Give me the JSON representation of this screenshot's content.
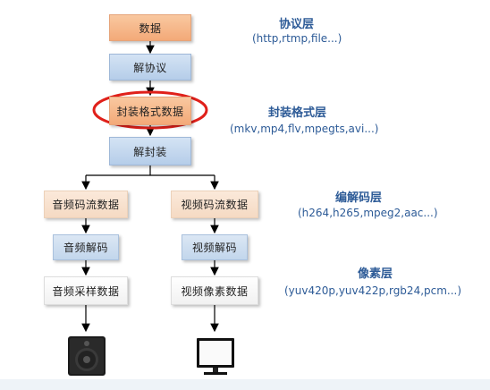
{
  "nodes": {
    "data": "数据",
    "deprotocol": "解协议",
    "container_data": "封装格式数据",
    "demux": "解封装",
    "audio_stream": "音频码流数据",
    "video_stream": "视频码流数据",
    "audio_decode": "音频解码",
    "video_decode": "视频解码",
    "audio_samples": "音频采样数据",
    "video_pixels": "视频像素数据"
  },
  "layers": [
    {
      "title": "协议层",
      "subtitle": "(http,rtmp,file...)"
    },
    {
      "title": "封装格式层",
      "subtitle": "(mkv,mp4,flv,mpegts,avi...)"
    },
    {
      "title": "编解码层",
      "subtitle": "(h264,h265,mpeg2,aac...)"
    },
    {
      "title": "像素层",
      "subtitle": "(yuv420p,yuv422p,rgb24,pcm...)"
    }
  ],
  "icons": [
    "speaker-icon",
    "monitor-icon"
  ],
  "colors": {
    "layer_text": "#2d5b97",
    "highlight_ellipse": "#e0201a",
    "orange_box": "#f3a978",
    "blue_box": "#b5cde9"
  }
}
